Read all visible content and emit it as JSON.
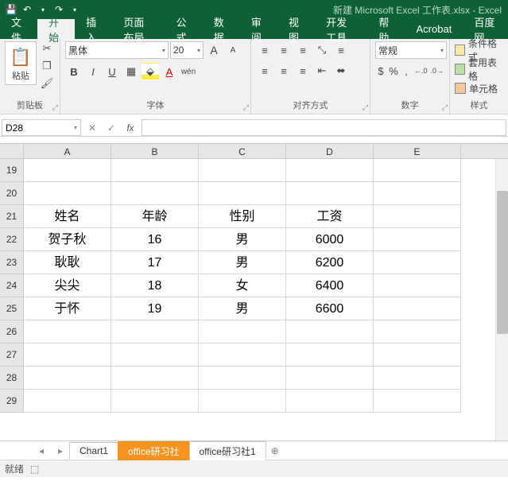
{
  "title": "新建 Microsoft Excel 工作表.xlsx - Excel",
  "qat": {
    "save": "💾",
    "undo": "↶",
    "redo": "↷"
  },
  "tabs": {
    "file": "文件",
    "home": "开始",
    "insert": "插入",
    "layout": "页面布局",
    "formulas": "公式",
    "data": "数据",
    "review": "审阅",
    "view": "视图",
    "dev": "开发工具",
    "help": "帮助",
    "acrobat": "Acrobat",
    "baidu": "百度网"
  },
  "clipboard": {
    "paste": "粘贴",
    "paste_icon": "📋",
    "cut_icon": "✂",
    "copy_icon": "❐",
    "painter_icon": "🖌",
    "group": "剪贴板"
  },
  "font": {
    "name": "黑体",
    "size": "20",
    "group": "字体",
    "bold": "B",
    "italic": "I",
    "underline": "U",
    "grow": "A",
    "shrink": "A",
    "phonetic": "wén"
  },
  "align": {
    "group": "对齐方式",
    "wrap": "≡",
    "merge": "⬌"
  },
  "number": {
    "format": "常规",
    "group": "数字",
    "currency": "$",
    "percent": "%",
    "comma": ",",
    "inc": "←.0",
    "dec": ".0→"
  },
  "styles": {
    "group": "样式",
    "conditional": "条件格式",
    "table": "套用表格",
    "cell": "单元格"
  },
  "namebox": "D28",
  "fx": {
    "cancel": "✕",
    "enter": "✓",
    "fx": "fx"
  },
  "columns": [
    "A",
    "B",
    "C",
    "D",
    "E"
  ],
  "rows": [
    "19",
    "20",
    "21",
    "22",
    "23",
    "24",
    "25",
    "26",
    "27",
    "28",
    "29"
  ],
  "cells": {
    "r21": {
      "A": "姓名",
      "B": "年龄",
      "C": "性别",
      "D": "工资",
      "E": ""
    },
    "r22": {
      "A": "贺子秋",
      "B": "16",
      "C": "男",
      "D": "6000",
      "E": ""
    },
    "r23": {
      "A": "耿耿",
      "B": "17",
      "C": "男",
      "D": "6200",
      "E": ""
    },
    "r24": {
      "A": "尖尖",
      "B": "18",
      "C": "女",
      "D": "6400",
      "E": ""
    },
    "r25": {
      "A": "于怀",
      "B": "19",
      "C": "男",
      "D": "6600",
      "E": ""
    }
  },
  "sheets": {
    "s1": "Chart1",
    "s2": "office研习社",
    "s3": "office研习社1",
    "add": "⊕"
  },
  "status": {
    "ready": "就绪",
    "rec": "⬚"
  }
}
